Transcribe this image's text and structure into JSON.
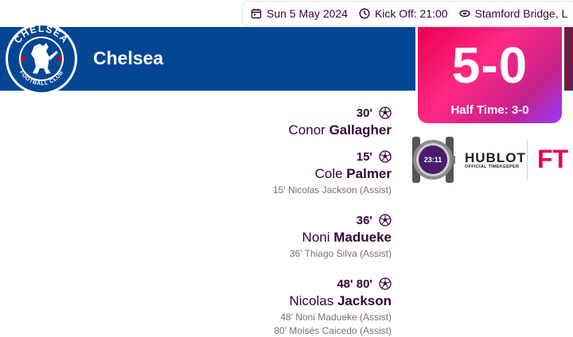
{
  "match_info": {
    "date": "Sun 5 May 2024",
    "kickoff": "Kick Off: 21:00",
    "venue": "Stamford Bridge, L"
  },
  "home_team": {
    "name": "Chelsea",
    "crest_text_top": "CHELSEA",
    "crest_text_bottom": "FOOTBALL CLUB",
    "color": "#034694"
  },
  "score": {
    "value": "5-0",
    "half_time": "Half Time: 3-0"
  },
  "sponsor": {
    "name": "HUBLOT",
    "tagline": "OFFICIAL TIMEKEEPER",
    "clock": "23:11",
    "status": "FT"
  },
  "goals": [
    {
      "time": "30'",
      "first": "Conor",
      "last": "Gallagher",
      "assists": []
    },
    {
      "time": "15'",
      "first": "Cole",
      "last": "Palmer",
      "assists": [
        "15' Nicolas Jackson (Assist)"
      ]
    },
    {
      "time": "36'",
      "first": "Noni",
      "last": "Madueke",
      "assists": [
        "36' Thiago Silva (Assist)"
      ]
    },
    {
      "time": "48' 80'",
      "first": "Nicolas",
      "last": "Jackson",
      "assists": [
        "48' Noni Madueke (Assist)",
        "80' Moisés Caicedo (Assist)"
      ]
    }
  ],
  "colors": {
    "primary": "#37003c",
    "accent": "#e90052",
    "gradient_end": "#963cff"
  }
}
